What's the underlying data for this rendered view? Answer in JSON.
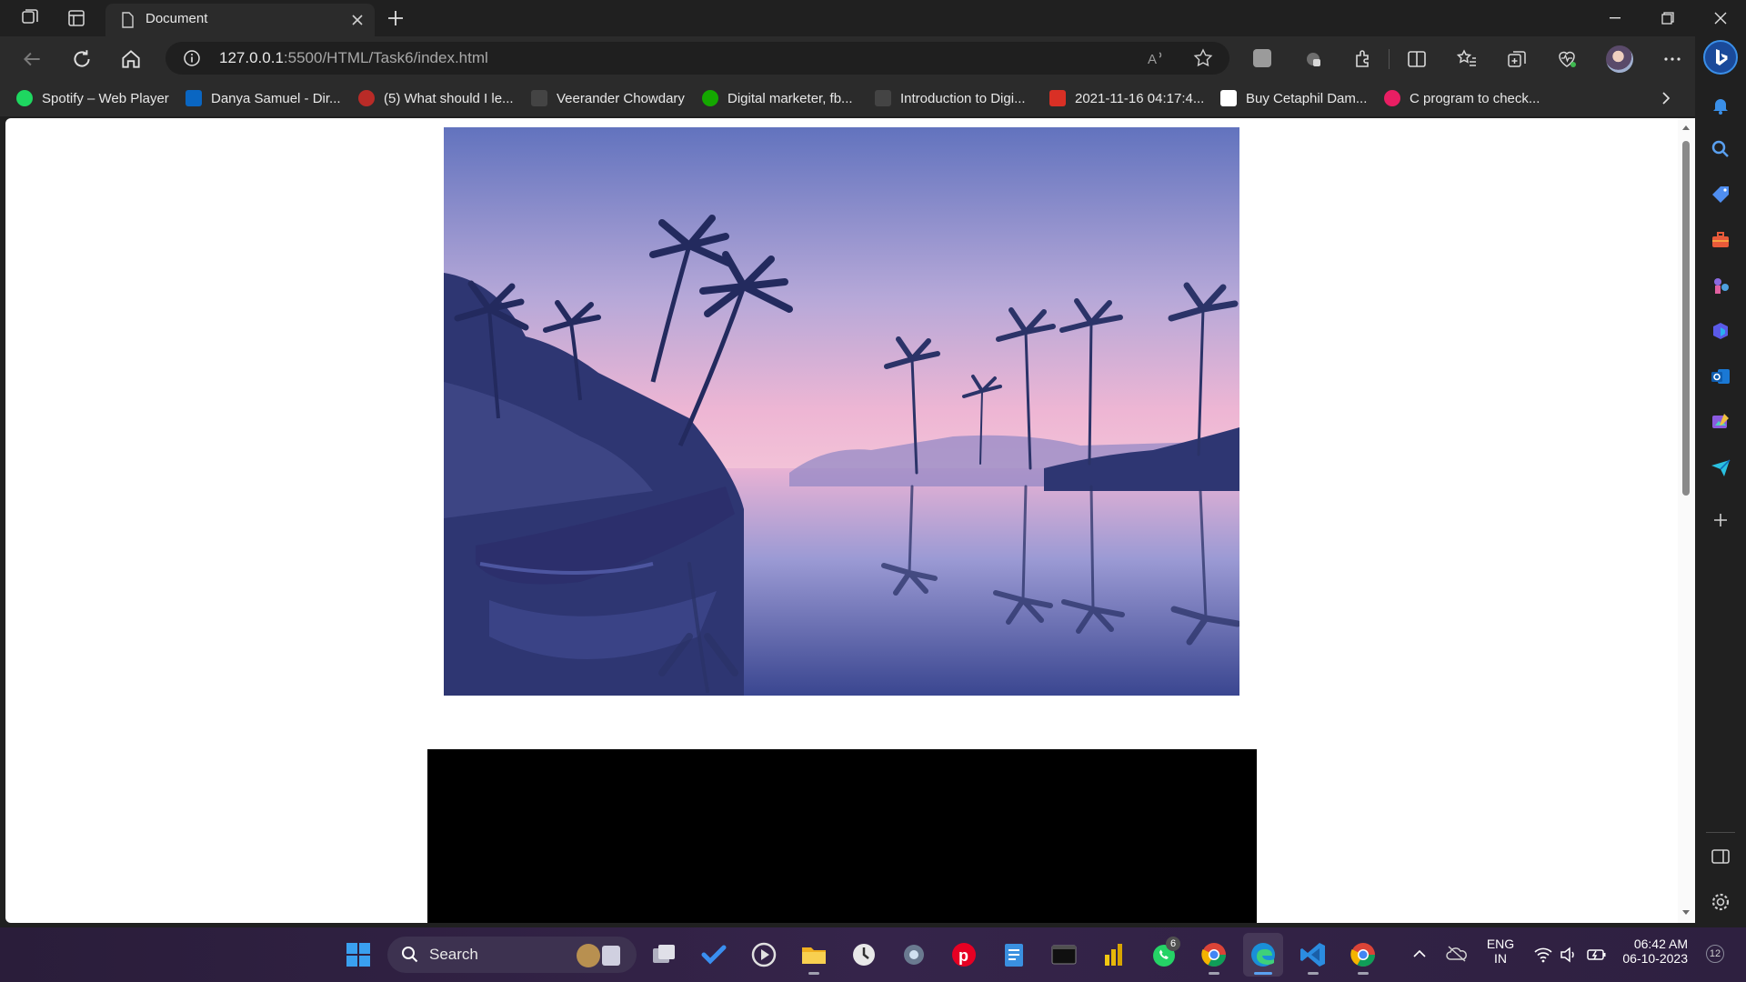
{
  "browser": {
    "tab_title": "Document",
    "address_host": "127.0.0.1",
    "address_path": ":5500/HTML/Task6/index.html"
  },
  "bookmarks": [
    {
      "label": "Spotify – Web Player",
      "icon": "spotify-icon",
      "color": "#1ed760"
    },
    {
      "label": "Danya Samuel - Dir...",
      "icon": "linkedin-icon",
      "color": "#0a66c2"
    },
    {
      "label": "(5) What should I le...",
      "icon": "quora-icon",
      "color": "#b92b27"
    },
    {
      "label": "Veerander Chowdary",
      "icon": "page-icon",
      "color": "#444444"
    },
    {
      "label": "Digital marketer, fb...",
      "icon": "upwork-icon",
      "color": "#14a800"
    },
    {
      "label": "Introduction to Digi...",
      "icon": "page-icon",
      "color": "#444444"
    },
    {
      "label": "2021-11-16 04:17:4...",
      "icon": "pdf-icon",
      "color": "#d93025"
    },
    {
      "label": "Buy Cetaphil Dam...",
      "icon": "amazon-icon",
      "color": "#ffffff"
    },
    {
      "label": "C program to check...",
      "icon": "tutorial-icon",
      "color": "#e91e63"
    }
  ],
  "page": {
    "image_alt": "tropical-lagoon-image",
    "video_bg": "#000000"
  },
  "taskbar": {
    "search_label": "Search",
    "lang_top": "ENG",
    "lang_bottom": "IN",
    "time": "06:42 AM",
    "date": "06-10-2023",
    "whatsapp_badge": "6",
    "notif_count": "12"
  },
  "colors": {
    "accent": "#0078d4",
    "chrome_bg": "#2b2b2b",
    "title_bg": "#202020"
  }
}
